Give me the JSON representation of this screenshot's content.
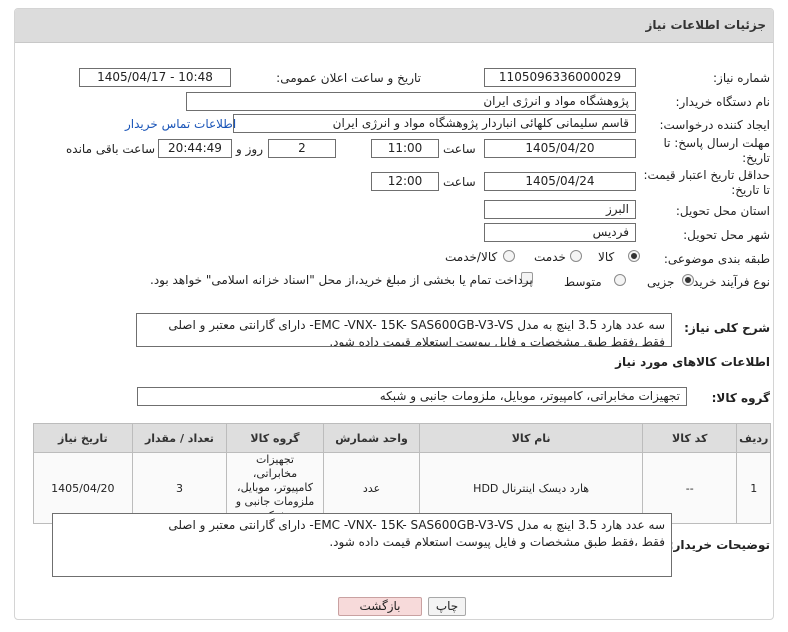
{
  "header": {
    "title": "جزئیات اطلاعات نیاز"
  },
  "fields": {
    "need_number_label": "شماره نیاز:",
    "need_number": "1105096336000029",
    "announce_label": "تاریخ و ساعت اعلان عمومی:",
    "announce_value": "1405/04/17 - 10:48",
    "buyer_org_label": "نام دستگاه خریدار:",
    "buyer_org": "پژوهشگاه مواد و انرژی ایران",
    "requester_label": "ایجاد کننده درخواست:",
    "requester": "قاسم سلیمانی کلهائی انباردار پژوهشگاه مواد و انرژی ایران",
    "contact_link": "اطلاعات تماس خریدار",
    "deadline_label_1": "مهلت ارسال پاسخ: تا",
    "deadline_label_2": "تاریخ:",
    "deadline_date": "1405/04/20",
    "time_label": "ساعت",
    "deadline_time": "11:00",
    "days_value": "2",
    "days_label": "روز و",
    "remaining_time": "20:44:49",
    "remaining_label": "ساعت باقی مانده",
    "validity_label_1": "حداقل تاریخ اعتبار قیمت:",
    "validity_label_2": "تا تاریخ:",
    "validity_date": "1405/04/24",
    "validity_time": "12:00",
    "province_label": "استان محل تحویل:",
    "province": "البرز",
    "city_label": "شهر محل تحویل:",
    "city": "فردیس",
    "category_label": "طبقه بندی موضوعی:",
    "category_options": [
      "کالا",
      "خدمت",
      "کالا/خدمت"
    ],
    "process_label": "نوع فرآیند خرید :",
    "process_options": [
      "جزیی",
      "متوسط"
    ],
    "payment_note": "پرداخت تمام یا بخشی از مبلغ خرید،از محل \"اسناد خزانه اسلامی\" خواهد بود."
  },
  "description": {
    "label": "شرح کلی نیاز:",
    "text": "سه عدد هارد 3.5 اینچ به مدل  EMC -VNX- 15K- SAS600GB-V3-VS- دارای گارانتی معتبر و اصلی\nفقط ،فقط طبق مشخصات  و فایل پیوست استعلام قیمت داده شود."
  },
  "goods_section": {
    "title": "اطلاعات کالاهای مورد نیاز",
    "group_label": "گروه کالا:",
    "group_value": "تجهیزات مخابراتی، کامپیوتر، موبایل، ملزومات جانبی و شبکه"
  },
  "table": {
    "headers": [
      "ردیف",
      "کد کالا",
      "نام کالا",
      "واحد شمارش",
      "گروه کالا",
      "تعداد / مقدار",
      "تاریخ نیاز"
    ],
    "rows": [
      [
        "1",
        "--",
        "هارد دیسک اینترنال HDD",
        "عدد",
        "تجهیزات مخابراتی، کامپیوتر، موبایل، ملزومات جانبی و شبکه",
        "3",
        "1405/04/20"
      ]
    ]
  },
  "buyer_notes": {
    "label": "توضیحات خریدار:",
    "text": "سه عدد هارد 3.5 اینچ به مدل  EMC -VNX- 15K- SAS600GB-V3-VS- دارای گارانتی معتبر و اصلی\nفقط ،فقط طبق مشخصات  و فایل پیوست استعلام قیمت داده شود."
  },
  "buttons": {
    "print": "چاپ",
    "back": "بازگشت"
  },
  "colors": {
    "link": "#1a55b8",
    "back_button": "#f7dada",
    "header_bg": "#dcdcdc"
  }
}
